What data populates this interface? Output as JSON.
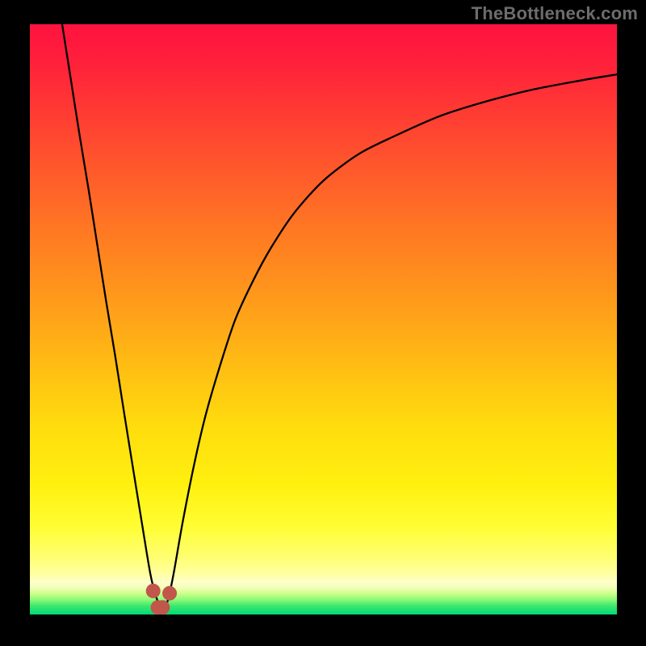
{
  "watermark": "TheBottleneck.com",
  "plot": {
    "inner_x": 37,
    "inner_y": 30,
    "inner_w": 727,
    "inner_h": 731
  },
  "gradient": {
    "stops": [
      {
        "offset": 0.0,
        "color": "#ff133f"
      },
      {
        "offset": 0.06,
        "color": "#ff1f3b"
      },
      {
        "offset": 0.15,
        "color": "#ff3b33"
      },
      {
        "offset": 0.25,
        "color": "#ff5a2b"
      },
      {
        "offset": 0.36,
        "color": "#ff7b22"
      },
      {
        "offset": 0.48,
        "color": "#ff9e1a"
      },
      {
        "offset": 0.58,
        "color": "#ffbd13"
      },
      {
        "offset": 0.68,
        "color": "#ffdc0e"
      },
      {
        "offset": 0.78,
        "color": "#fff00f"
      },
      {
        "offset": 0.85,
        "color": "#fffd32"
      },
      {
        "offset": 0.905,
        "color": "#ffff74"
      },
      {
        "offset": 0.93,
        "color": "#ffffa0"
      },
      {
        "offset": 0.945,
        "color": "#ffffc9"
      },
      {
        "offset": 0.955,
        "color": "#f2ffb8"
      },
      {
        "offset": 0.965,
        "color": "#c9ff88"
      },
      {
        "offset": 0.975,
        "color": "#8cf97a"
      },
      {
        "offset": 0.985,
        "color": "#3fe96e"
      },
      {
        "offset": 1.0,
        "color": "#00d975"
      }
    ]
  },
  "chart_data": {
    "type": "line",
    "title": "",
    "xlabel": "",
    "ylabel": "",
    "xlim": [
      0,
      1
    ],
    "ylim": [
      0,
      1
    ],
    "note": "Axes unlabeled; values are normalized fractions of the plot area (x right, y up). The curve touches y≈0 near x≈0.21–0.24 and rises on both sides.",
    "series": [
      {
        "name": "curve",
        "x": [
          0.055,
          0.07,
          0.085,
          0.1,
          0.115,
          0.13,
          0.145,
          0.16,
          0.175,
          0.19,
          0.205,
          0.215,
          0.225,
          0.235,
          0.245,
          0.26,
          0.28,
          0.3,
          0.325,
          0.35,
          0.38,
          0.41,
          0.45,
          0.5,
          0.56,
          0.62,
          0.7,
          0.78,
          0.86,
          0.94,
          1.0
        ],
        "values": [
          1.0,
          0.905,
          0.81,
          0.72,
          0.625,
          0.53,
          0.44,
          0.345,
          0.252,
          0.16,
          0.07,
          0.03,
          0.01,
          0.024,
          0.07,
          0.155,
          0.255,
          0.34,
          0.425,
          0.5,
          0.565,
          0.62,
          0.68,
          0.735,
          0.78,
          0.81,
          0.845,
          0.87,
          0.89,
          0.905,
          0.915
        ]
      },
      {
        "name": "minimum-markers",
        "x": [
          0.21,
          0.218,
          0.226,
          0.238
        ],
        "values": [
          0.04,
          0.012,
          0.012,
          0.036
        ]
      }
    ]
  }
}
